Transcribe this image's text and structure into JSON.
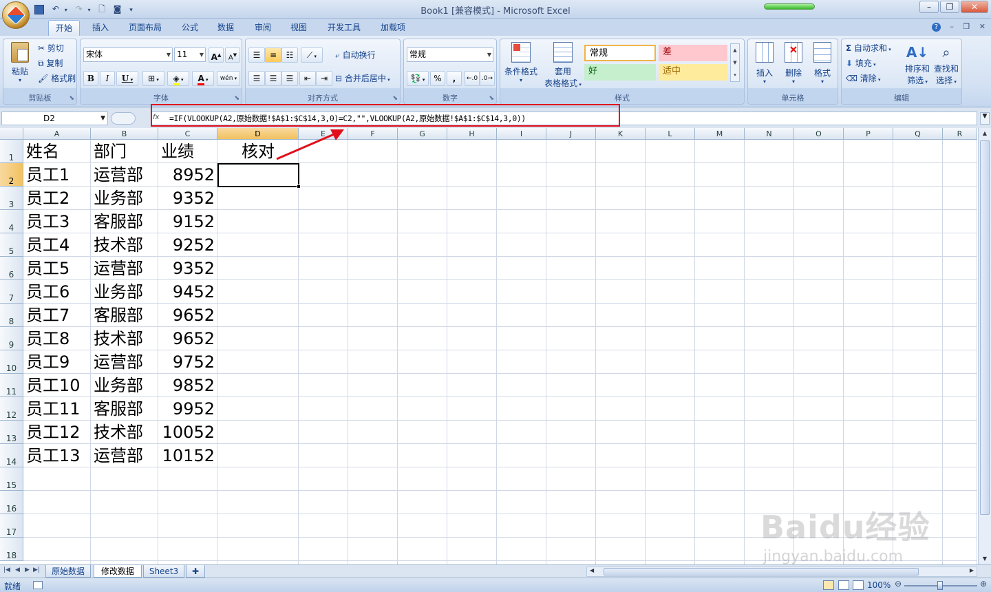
{
  "window": {
    "title": "Book1  [兼容模式] - Microsoft Excel"
  },
  "ribbon_tabs": [
    "开始",
    "插入",
    "页面布局",
    "公式",
    "数据",
    "审阅",
    "视图",
    "开发工具",
    "加载项"
  ],
  "clipboard": {
    "paste": "粘贴",
    "cut": "剪切",
    "copy": "复制",
    "format_painter": "格式刷",
    "label": "剪贴板"
  },
  "font": {
    "name": "宋体",
    "size": "11",
    "grow": "A",
    "shrink": "A",
    "bold": "B",
    "italic": "I",
    "underline": "U",
    "phonetic": "wén",
    "label": "字体"
  },
  "alignment": {
    "wrap_text": "自动换行",
    "merge_center": "合并后居中",
    "label": "对齐方式"
  },
  "number": {
    "format": "常规",
    "percent": "%",
    "comma": ",",
    "label": "数字"
  },
  "styles": {
    "conditional": "条件格式",
    "table_line1": "套用",
    "table_line2": "表格格式",
    "normal": "常规",
    "bad": "差",
    "good": "好",
    "neutral": "适中",
    "label": "样式"
  },
  "cells": {
    "insert": "插入",
    "delete": "删除",
    "format": "格式",
    "label": "单元格"
  },
  "editing": {
    "autosum": "自动求和",
    "fill": "填充",
    "clear": "清除",
    "sort_line1": "排序和",
    "sort_line2": "筛选",
    "find_line1": "查找和",
    "find_line2": "选择",
    "label": "编辑"
  },
  "formula_bar": {
    "name_box": "D2",
    "fx": "fx",
    "formula": "=IF(VLOOKUP(A2,原始数据!$A$1:$C$14,3,0)=C2,\"\",VLOOKUP(A2,原始数据!$A$1:$C$14,3,0))"
  },
  "columns": [
    "A",
    "B",
    "C",
    "D",
    "E",
    "F",
    "G",
    "H",
    "I",
    "J",
    "K",
    "L",
    "M",
    "N",
    "O",
    "P",
    "Q",
    "R"
  ],
  "rows": [
    "1",
    "2",
    "3",
    "4",
    "5",
    "6",
    "7",
    "8",
    "9",
    "10",
    "11",
    "12",
    "13",
    "14",
    "15",
    "16",
    "17",
    "18"
  ],
  "table": {
    "headers": [
      "姓名",
      "部门",
      "业绩",
      "核对"
    ],
    "data": [
      [
        "员工1",
        "运营部",
        "8952"
      ],
      [
        "员工2",
        "业务部",
        "9352"
      ],
      [
        "员工3",
        "客服部",
        "9152"
      ],
      [
        "员工4",
        "技术部",
        "9252"
      ],
      [
        "员工5",
        "运营部",
        "9352"
      ],
      [
        "员工6",
        "业务部",
        "9452"
      ],
      [
        "员工7",
        "客服部",
        "9652"
      ],
      [
        "员工8",
        "技术部",
        "9652"
      ],
      [
        "员工9",
        "运营部",
        "9752"
      ],
      [
        "员工10",
        "业务部",
        "9852"
      ],
      [
        "员工11",
        "客服部",
        "9952"
      ],
      [
        "员工12",
        "技术部",
        "10052"
      ],
      [
        "员工13",
        "运营部",
        "10152"
      ]
    ]
  },
  "sheet_tabs": [
    "原始数据",
    "修改数据",
    "Sheet3"
  ],
  "active_sheet": "修改数据",
  "status": {
    "mode": "就绪",
    "zoom": "100%"
  },
  "watermark": {
    "brand": "Baidu经验",
    "url": "jingyan.baidu.com"
  },
  "colors": {
    "annotation": "#e10f1a",
    "selection_header": "#f1c15f",
    "bad_fill": "#ffc7ce",
    "good_fill": "#c6efce",
    "neutral_fill": "#ffeb9c"
  }
}
